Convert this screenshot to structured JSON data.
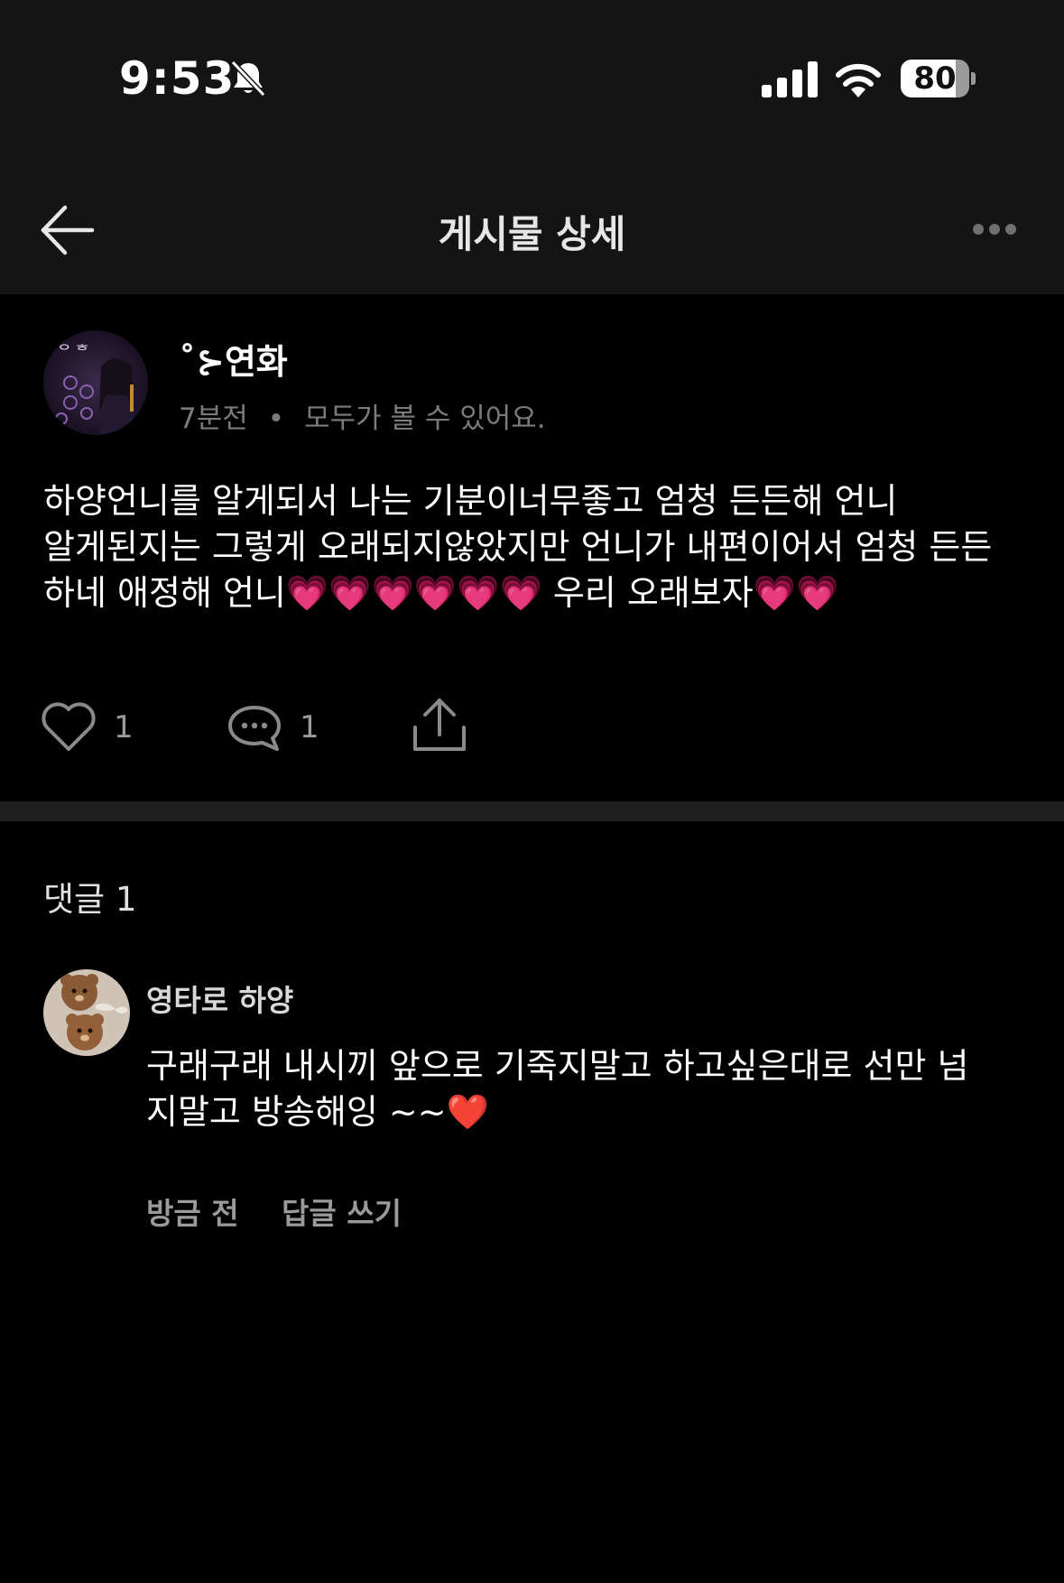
{
  "status_bar": {
    "time": "9:53",
    "battery": "80",
    "battery_level": 0.8
  },
  "header": {
    "title": "게시물 상세"
  },
  "post": {
    "author": "˚⊱연화",
    "time": "7분전",
    "separator": "•",
    "visibility": "모두가 볼 수 있어요.",
    "body": "하양언니를 알게되서 나는 기분이너무좋고 엄청 든든해 언니\n알게된지는 그렇게 오래되지않았지만 언니가 내편이어서 엄청 든든\n하네 애정해 언니💗💗💗💗💗💗 우리 오래보자💗💗",
    "like_count": "1",
    "comment_count": "1"
  },
  "comments": {
    "heading": "댓글 1",
    "items": [
      {
        "author": "영타로 하양",
        "text": "구래구래 내시끼 앞으로 기죽지말고 하고싶은대로 선만 넘\n지말고 방송해잉 ~~❤️",
        "time": "방금 전",
        "reply_label": "답글 쓰기"
      }
    ]
  },
  "colors": {
    "background": "#000000",
    "bar": "#141414",
    "divider": "#1e1e1e",
    "muted_text": "#7b7b7b"
  },
  "icons": [
    "bell-slash-icon",
    "signal-icon",
    "wifi-icon",
    "battery-icon",
    "back-arrow-icon",
    "more-icon",
    "heart-icon",
    "comment-icon",
    "share-icon"
  ]
}
